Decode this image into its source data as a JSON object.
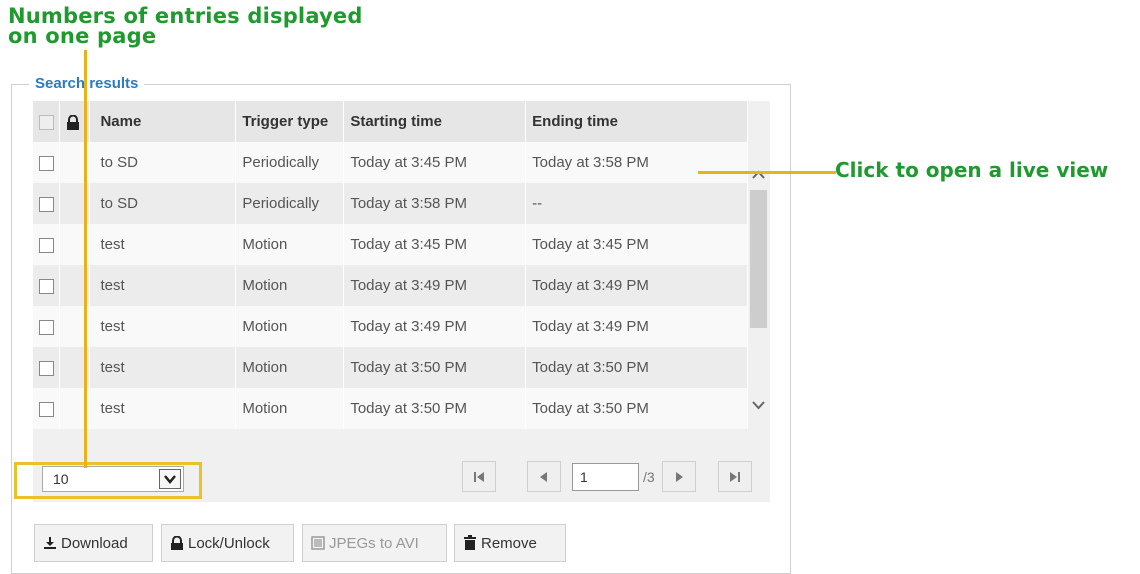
{
  "annotations": {
    "entries_per_page_line1": "Numbers of entries displayed",
    "entries_per_page_line2": "on one page",
    "live_view": "Click to open a live view"
  },
  "search_results": {
    "legend": "Search results",
    "columns": [
      "Name",
      "Trigger type",
      "Starting time",
      "Ending time"
    ],
    "rows": [
      {
        "name": "to SD",
        "trigger": "Periodically",
        "start": "Today at 3:45 PM",
        "end": "Today at 3:58 PM"
      },
      {
        "name": "to SD",
        "trigger": "Periodically",
        "start": "Today at 3:58 PM",
        "end": "--"
      },
      {
        "name": "test",
        "trigger": "Motion",
        "start": "Today at 3:45 PM",
        "end": "Today at 3:45 PM"
      },
      {
        "name": "test",
        "trigger": "Motion",
        "start": "Today at 3:49 PM",
        "end": "Today at 3:49 PM"
      },
      {
        "name": "test",
        "trigger": "Motion",
        "start": "Today at 3:49 PM",
        "end": "Today at 3:49 PM"
      },
      {
        "name": "test",
        "trigger": "Motion",
        "start": "Today at 3:50 PM",
        "end": "Today at 3:50 PM"
      },
      {
        "name": "test",
        "trigger": "Motion",
        "start": "Today at 3:50 PM",
        "end": "Today at 3:50 PM"
      }
    ]
  },
  "pagination": {
    "entries_per_page": "10",
    "current_page": "1",
    "total_pages": "/3"
  },
  "toolbar": {
    "download": "Download",
    "lock_unlock": "Lock/Unlock",
    "jpegs_to_avi": "JPEGs to AVI",
    "remove": "Remove"
  },
  "colors": {
    "annotation_green": "#1f9a2e",
    "annotation_yellow": "#e8b21a",
    "legend_blue": "#2a7bc4"
  }
}
